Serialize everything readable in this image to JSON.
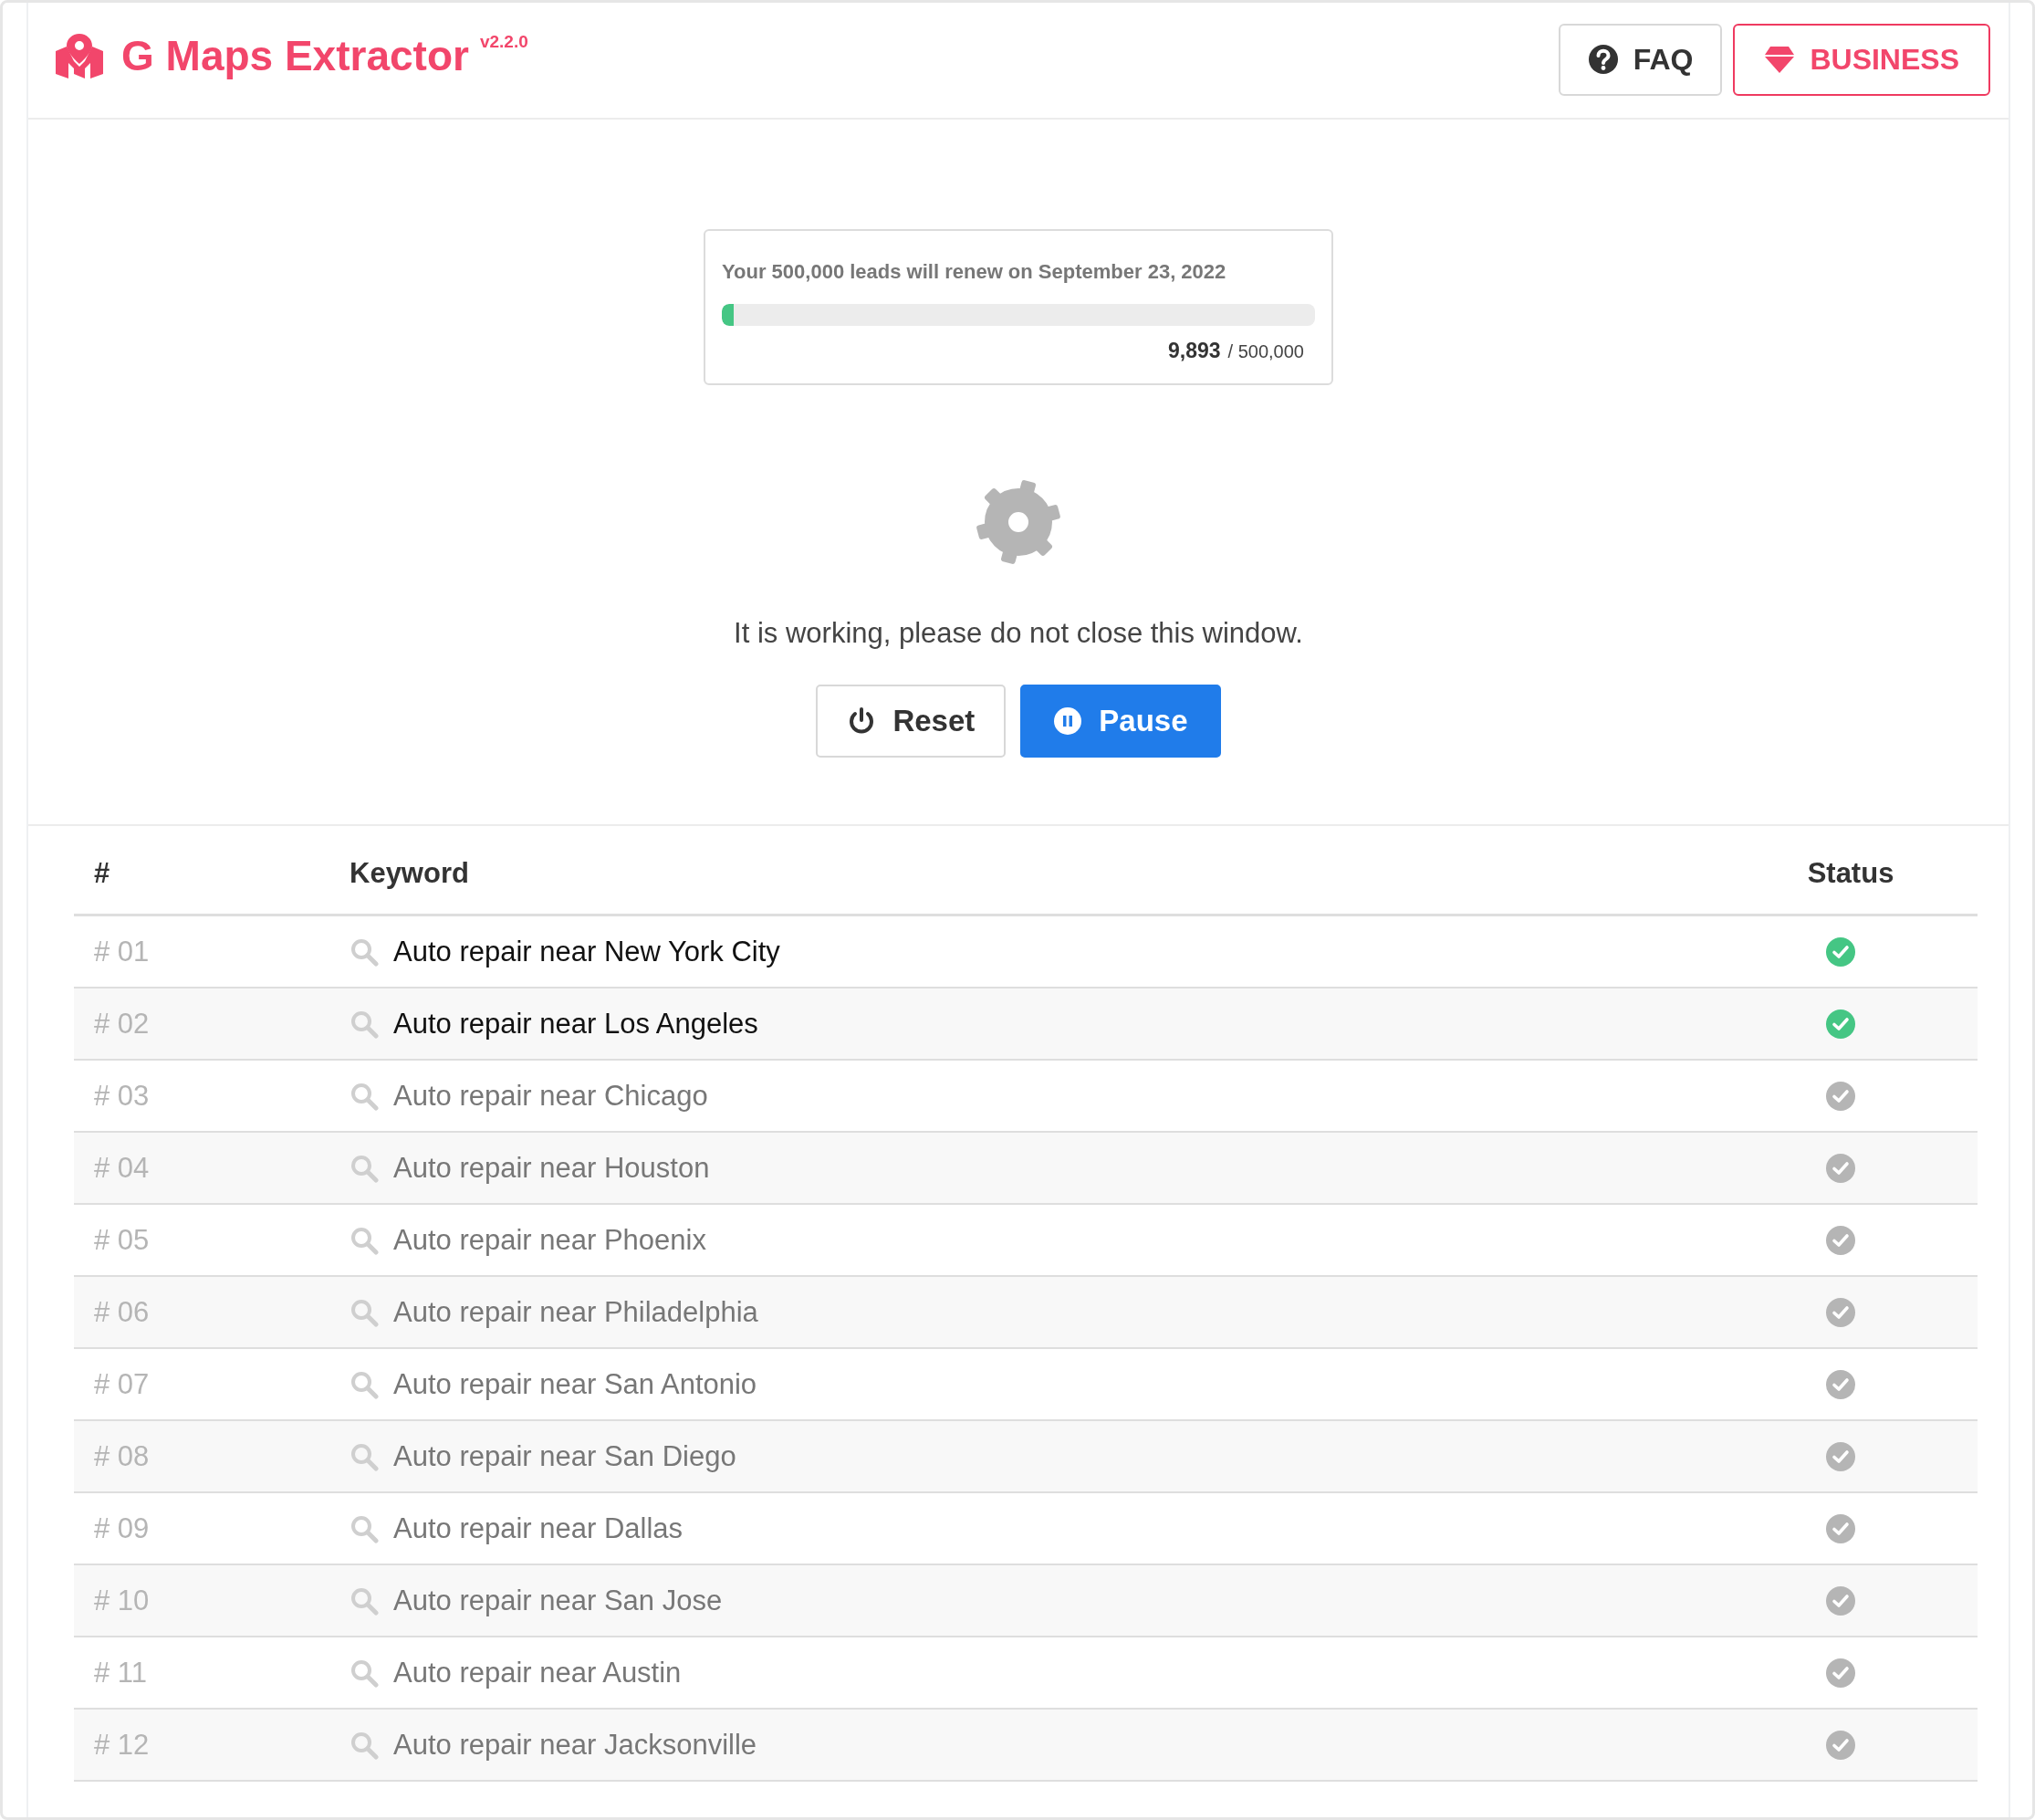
{
  "header": {
    "title": "G Maps Extractor",
    "version": "v2.2.0",
    "buttons": [
      {
        "kind": "faq",
        "label": "FAQ"
      },
      {
        "kind": "business",
        "label": "BUSINESS"
      }
    ]
  },
  "quota": {
    "message": "Your 500,000 leads will renew on September 23, 2022",
    "level": 0.0198,
    "used": "9,893",
    "total": "/ 500,000"
  },
  "status": {
    "message": "It is working, please do not close this window.",
    "buttons": [
      {
        "kind": "reset",
        "label": "Reset"
      },
      {
        "kind": "pause",
        "label": "Pause"
      }
    ]
  },
  "table": {
    "columns": [
      "#",
      "Keyword",
      "Status"
    ],
    "rows": [
      {
        "number": "# 01",
        "keyword": "Auto repair near New York City",
        "done": true
      },
      {
        "number": "# 02",
        "keyword": "Auto repair near Los Angeles",
        "done": true
      },
      {
        "number": "# 03",
        "keyword": "Auto repair near Chicago",
        "done": false
      },
      {
        "number": "# 04",
        "keyword": "Auto repair near Houston",
        "done": false
      },
      {
        "number": "# 05",
        "keyword": "Auto repair near Phoenix",
        "done": false
      },
      {
        "number": "# 06",
        "keyword": "Auto repair near Philadelphia",
        "done": false
      },
      {
        "number": "# 07",
        "keyword": "Auto repair near San Antonio",
        "done": false
      },
      {
        "number": "# 08",
        "keyword": "Auto repair near San Diego",
        "done": false
      },
      {
        "number": "# 09",
        "keyword": "Auto repair near Dallas",
        "done": false
      },
      {
        "number": "# 10",
        "keyword": "Auto repair near San Jose",
        "done": false
      },
      {
        "number": "# 11",
        "keyword": "Auto repair near Austin",
        "done": false
      },
      {
        "number": "# 12",
        "keyword": "Auto repair near Jacksonville",
        "done": false
      }
    ]
  }
}
